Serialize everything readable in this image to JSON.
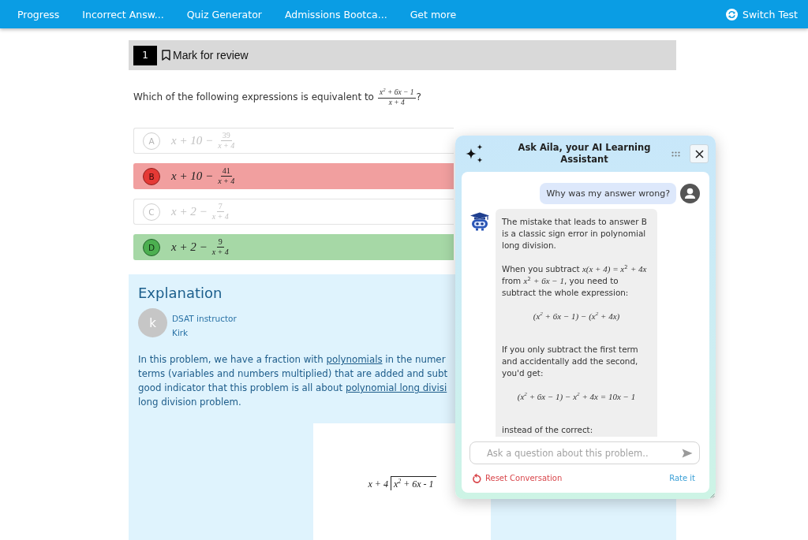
{
  "nav": {
    "items": [
      "Progress",
      "Incorrect Answ...",
      "Quiz Generator",
      "Admissions Bootca...",
      "Get more"
    ],
    "switch_test": "Switch Test"
  },
  "question": {
    "number": "1",
    "mark_for_review": {
      "label": "Mark for review",
      "marked": false
    },
    "prompt": "Which of the following expressions is equivalent to",
    "fraction": {
      "numerator": "x$^{2}$ + 6x − 1",
      "denominator": "x + 4"
    },
    "end": "?"
  },
  "options": [
    {
      "letter": "A",
      "expression": "x + 10 −",
      "numerator": "39",
      "denominator": "x + 4",
      "selected": false,
      "correct": false
    },
    {
      "letter": "B",
      "expression": "x + 10 −",
      "numerator": "41",
      "denominator": "x + 4",
      "selected": true,
      "correct": false
    },
    {
      "letter": "C",
      "expression": "x + 2 −",
      "numerator": "7",
      "denominator": "x + 4",
      "selected": false,
      "correct": false
    },
    {
      "letter": "D",
      "expression": "x + 2 −",
      "numerator": "9",
      "denominator": "x + 4",
      "selected": false,
      "correct": true
    }
  ],
  "explanation": {
    "title": "Explanation",
    "author": {
      "initial": "k",
      "role": "DSAT instructor",
      "name": "Kirk"
    },
    "paragraph_lines": [
      [
        {
          "kind": "text",
          "text": "In this problem, we have a fraction with "
        },
        {
          "kind": "link",
          "text": "polynomials"
        },
        {
          "kind": "text",
          "text": " in the numer"
        }
      ],
      [
        {
          "kind": "text",
          "text": "terms (variables and numbers multiplied) that are added and subt"
        }
      ],
      [
        {
          "kind": "text",
          "text": "good indicator that this problem is all about "
        },
        {
          "kind": "link",
          "text": "polynomial long divisi"
        }
      ],
      [
        {
          "kind": "text",
          "text": "long division problem."
        }
      ]
    ],
    "figure": {
      "divisor": "x + 4",
      "dividend": "x$^{2}$ + 6x - 1"
    }
  },
  "assistant_panel": {
    "title": "Ask Aila, your AI Learning Assistant",
    "messages": [
      {
        "kind": "user",
        "text": "Why was my answer wrong?"
      },
      {
        "kind": "assistant",
        "blocks": [
          {
            "kind": "text",
            "text": "The mistake that leads to answer B is a classic sign error in polynomial long division."
          },
          {
            "kind": "text",
            "text": "When you subtract *x(x + 4) = x*$^{2}$ *+ 4x* from *x*$^{2}$ *+ 6x − 1*, you need to subtract the whole expression:"
          },
          {
            "kind": "math",
            "text": "(x$^{2}$ + 6x − 1) − (x$^{2}$ + 4x)"
          },
          {
            "kind": "text",
            "text": "If you only subtract the first term and accidentally add the second, you'd get:"
          },
          {
            "kind": "math",
            "text": "(x$^{2}$ + 6x − 1) − x$^{2}$ + 4x = 10x − 1"
          },
          {
            "kind": "text",
            "text": "instead of the correct:"
          }
        ]
      }
    ],
    "input": {
      "placeholder": "Ask a question about this problem.."
    },
    "reset": "Reset Conversation",
    "rate": "Rate it"
  }
}
